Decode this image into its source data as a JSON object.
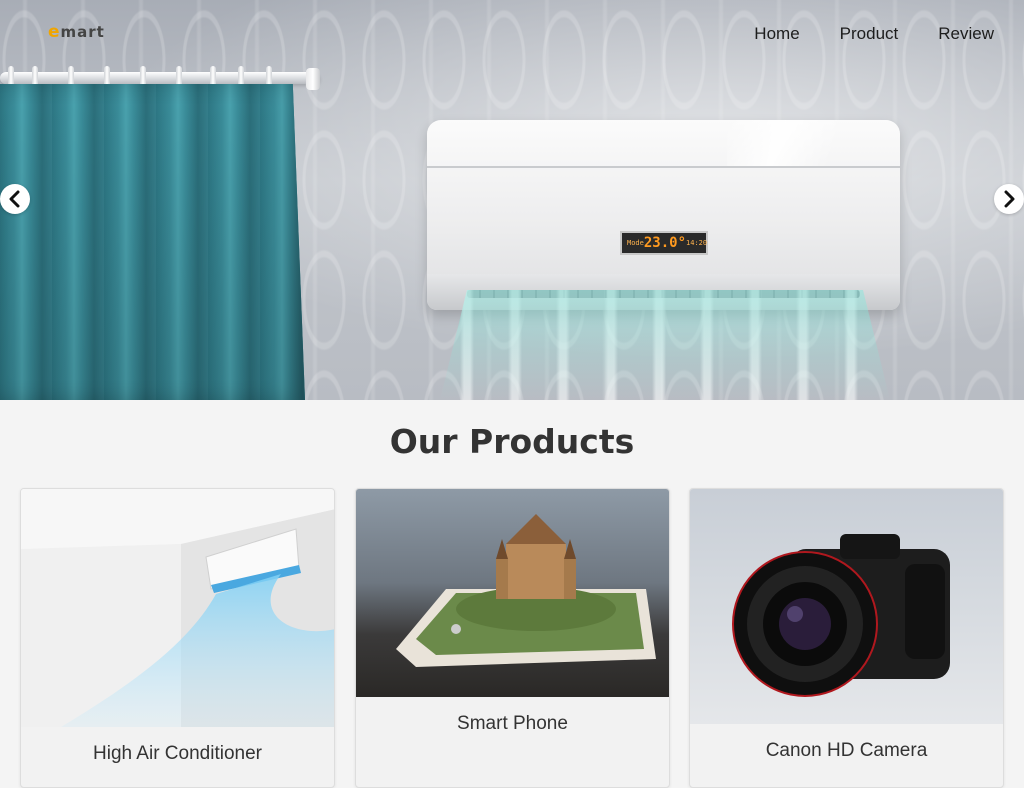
{
  "brand": {
    "logo_prefix": "e",
    "logo_rest": "mart"
  },
  "nav": {
    "items": [
      {
        "label": "Home"
      },
      {
        "label": "Product"
      },
      {
        "label": "Review"
      }
    ]
  },
  "hero": {
    "display": {
      "mode": "Mode",
      "temp": "23.0°",
      "time": "14:20"
    }
  },
  "products_section": {
    "title": "Our Products",
    "items": [
      {
        "name": "High Air Conditioner"
      },
      {
        "name": "Smart Phone"
      },
      {
        "name": "Canon HD Camera"
      }
    ]
  },
  "colors": {
    "accent": "#f0a500",
    "curtain": "#3a8c99",
    "text": "#333333"
  }
}
